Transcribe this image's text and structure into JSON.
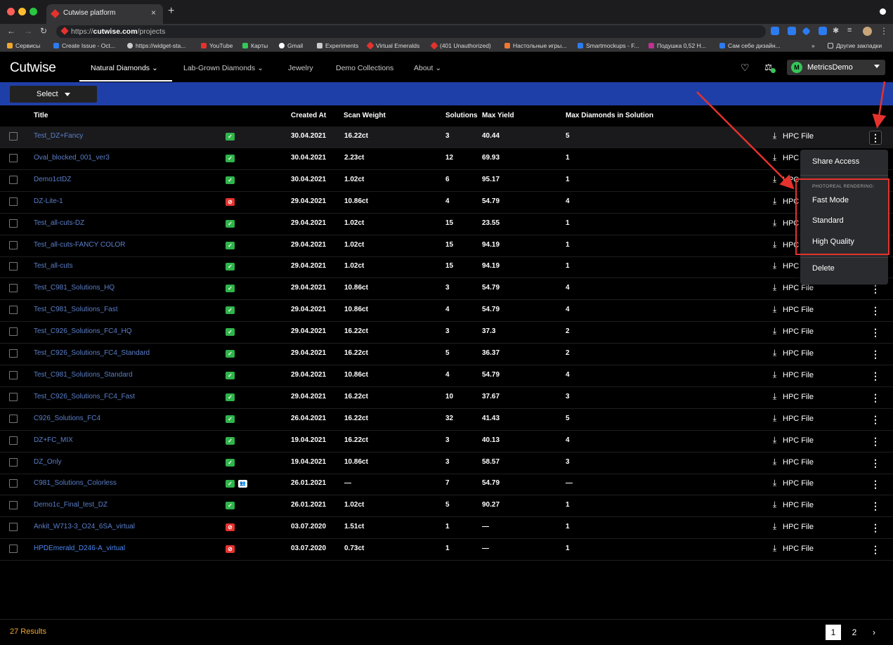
{
  "browser": {
    "tab_title": "Cutwise platform",
    "url_prefix": "https://",
    "url_host": "cutwise.com",
    "url_path": "/projects",
    "bookmarks": [
      {
        "label": "Сервисы",
        "color": "#f0a830"
      },
      {
        "label": "Create Issue - Oct...",
        "color": "#2d7bf0"
      },
      {
        "label": "https://widget-sta...",
        "color": "#cccccc"
      },
      {
        "label": "YouTube",
        "color": "#e5322d"
      },
      {
        "label": "Карты",
        "color": "#34c759"
      },
      {
        "label": "Gmail",
        "color": "#ffffff"
      },
      {
        "label": "Experiments",
        "color": "#cccccc"
      },
      {
        "label": "Virtual Emeralds",
        "color": "#e5322d"
      },
      {
        "label": "(401 Unauthorized)",
        "color": "#e5322d"
      },
      {
        "label": "Настольные игры...",
        "color": "#f07830"
      },
      {
        "label": "Smartmockups - F...",
        "color": "#2d7bf0"
      },
      {
        "label": "Подушка 0,52 Н...",
        "color": "#c03090"
      },
      {
        "label": "Сам себе дизайн...",
        "color": "#2d7bf0"
      }
    ],
    "other_bookmarks": "Другие закладки"
  },
  "header": {
    "logo": "Cutwise",
    "nav": [
      {
        "label": "Natural Diamonds",
        "dropdown": true
      },
      {
        "label": "Lab-Grown Diamonds",
        "dropdown": true
      },
      {
        "label": "Jewelry",
        "dropdown": false
      },
      {
        "label": "Demo Collections",
        "dropdown": false
      },
      {
        "label": "About",
        "dropdown": true
      }
    ],
    "user_initial": "M",
    "user_name": "MetricsDemo"
  },
  "toolbar": {
    "select_label": "Select"
  },
  "table": {
    "columns": {
      "title": "Title",
      "created_at": "Created At",
      "scan_weight": "Scan Weight",
      "solutions": "Solutions",
      "max_yield": "Max Yield",
      "max_diamonds": "Max Diamonds in Solution"
    },
    "rows": [
      {
        "title": "Test_DZ+Fancy",
        "status": "ok",
        "created": "30.04.2021",
        "weight": "16.22ct",
        "solutions": "3",
        "yield": "40.44",
        "diamonds": "5",
        "hpc": "HPC File"
      },
      {
        "title": "Oval_blocked_001_ver3",
        "status": "ok",
        "created": "30.04.2021",
        "weight": "2.23ct",
        "solutions": "12",
        "yield": "69.93",
        "diamonds": "1",
        "hpc": "HPC File"
      },
      {
        "title": "Demo1ctDZ",
        "status": "ok",
        "created": "30.04.2021",
        "weight": "1.02ct",
        "solutions": "6",
        "yield": "95.17",
        "diamonds": "1",
        "hpc": "HPC File"
      },
      {
        "title": "DZ-Lite-1",
        "status": "bad",
        "created": "29.04.2021",
        "weight": "10.86ct",
        "solutions": "4",
        "yield": "54.79",
        "diamonds": "4",
        "hpc": "HPC File"
      },
      {
        "title": "Test_all-cuts-DZ",
        "status": "ok",
        "created": "29.04.2021",
        "weight": "1.02ct",
        "solutions": "15",
        "yield": "23.55",
        "diamonds": "1",
        "hpc": "HPC File"
      },
      {
        "title": "Test_all-cuts-FANCY COLOR",
        "status": "ok",
        "created": "29.04.2021",
        "weight": "1.02ct",
        "solutions": "15",
        "yield": "94.19",
        "diamonds": "1",
        "hpc": "HPC File"
      },
      {
        "title": "Test_all-cuts",
        "status": "ok",
        "created": "29.04.2021",
        "weight": "1.02ct",
        "solutions": "15",
        "yield": "94.19",
        "diamonds": "1",
        "hpc": "HPC File"
      },
      {
        "title": "Test_C981_Solutions_HQ",
        "status": "ok",
        "created": "29.04.2021",
        "weight": "10.86ct",
        "solutions": "3",
        "yield": "54.79",
        "diamonds": "4",
        "hpc": "HPC File"
      },
      {
        "title": "Test_C981_Solutions_Fast",
        "status": "ok",
        "created": "29.04.2021",
        "weight": "10.86ct",
        "solutions": "4",
        "yield": "54.79",
        "diamonds": "4",
        "hpc": "HPC File"
      },
      {
        "title": "Test_C926_Solutions_FC4_HQ",
        "status": "ok",
        "created": "29.04.2021",
        "weight": "16.22ct",
        "solutions": "3",
        "yield": "37.3",
        "diamonds": "2",
        "hpc": "HPC File"
      },
      {
        "title": "Test_C926_Solutions_FC4_Standard",
        "status": "ok",
        "created": "29.04.2021",
        "weight": "16.22ct",
        "solutions": "5",
        "yield": "36.37",
        "diamonds": "2",
        "hpc": "HPC File"
      },
      {
        "title": "Test_C981_Solutions_Standard",
        "status": "ok",
        "created": "29.04.2021",
        "weight": "10.86ct",
        "solutions": "4",
        "yield": "54.79",
        "diamonds": "4",
        "hpc": "HPC File"
      },
      {
        "title": "Test_C926_Solutions_FC4_Fast",
        "status": "ok",
        "created": "29.04.2021",
        "weight": "16.22ct",
        "solutions": "10",
        "yield": "37.67",
        "diamonds": "3",
        "hpc": "HPC File"
      },
      {
        "title": "C926_Solutions_FC4",
        "status": "ok",
        "created": "26.04.2021",
        "weight": "16.22ct",
        "solutions": "32",
        "yield": "41.43",
        "diamonds": "5",
        "hpc": "HPC File"
      },
      {
        "title": "DZ+FC_MIX",
        "status": "ok",
        "created": "19.04.2021",
        "weight": "16.22ct",
        "solutions": "3",
        "yield": "40.13",
        "diamonds": "4",
        "hpc": "HPC File"
      },
      {
        "title": "DZ_Only",
        "status": "ok",
        "created": "19.04.2021",
        "weight": "10.86ct",
        "solutions": "3",
        "yield": "58.57",
        "diamonds": "3",
        "hpc": "HPC File"
      },
      {
        "title": "C981_Solutions_Colorless",
        "status": "ok",
        "shared": true,
        "created": "26.01.2021",
        "weight": "—",
        "solutions": "7",
        "yield": "54.79",
        "diamonds": "—",
        "hpc": "HPC File"
      },
      {
        "title": "Demo1c_Final_test_DZ",
        "status": "ok",
        "created": "26.01.2021",
        "weight": "1.02ct",
        "solutions": "5",
        "yield": "90.27",
        "diamonds": "1",
        "hpc": "HPC File"
      },
      {
        "title": "Ankit_W713-3_O24_6SA_virtual",
        "status": "bad",
        "created": "03.07.2020",
        "weight": "1.51ct",
        "solutions": "1",
        "yield": "—",
        "diamonds": "1",
        "hpc": "HPC File"
      },
      {
        "title": "HPDEmerald_D246-A_virtual",
        "status": "bad",
        "bright": true,
        "created": "03.07.2020",
        "weight": "0.73ct",
        "solutions": "1",
        "yield": "—",
        "diamonds": "1",
        "hpc": "HPC File"
      }
    ]
  },
  "menu": {
    "share_access": "Share Access",
    "section": "PHOTOREAL RENDERING:",
    "fast": "Fast Mode",
    "standard": "Standard",
    "high": "High Quality",
    "delete": "Delete"
  },
  "footer": {
    "results": "27 Results",
    "pages": [
      "1",
      "2"
    ],
    "next": "›"
  },
  "colors": {
    "accent_blue": "#1f3fa8",
    "annotation_red": "#e5322d",
    "ok_green": "#2fb54a",
    "results_orange": "#f0a830"
  }
}
